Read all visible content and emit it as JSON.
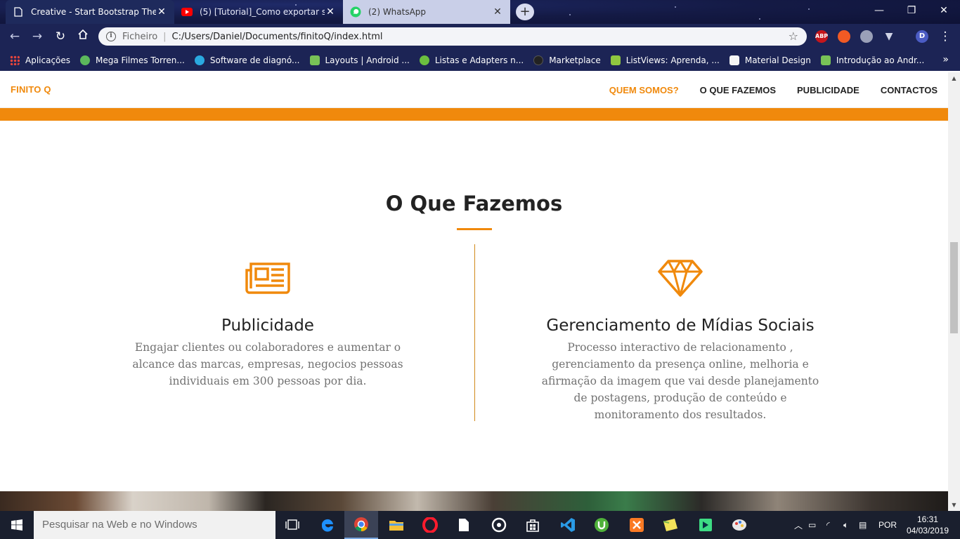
{
  "browser": {
    "tabs": [
      {
        "title": "Creative - Start Bootstrap Theme",
        "icon": "page-icon"
      },
      {
        "title": "(5) [Tutorial]_Como exportar seu",
        "icon": "youtube-icon"
      },
      {
        "title": "(2) WhatsApp",
        "icon": "whatsapp-icon"
      }
    ],
    "new_tab": "+",
    "address_scheme_label": "Ficheiro",
    "address_url": "C:/Users/Daniel/Documents/finitoQ/index.html",
    "extensions": [
      "ABP"
    ],
    "profile_initial": "D",
    "bookmarks": [
      {
        "label": "Aplicações",
        "color": "#e8453c"
      },
      {
        "label": "Mega Filmes Torren...",
        "color": "#5cb85c"
      },
      {
        "label": "Software de diagnó...",
        "color": "#2aa9e0"
      },
      {
        "label": "Layouts  |  Android ...",
        "color": "#78c257"
      },
      {
        "label": "Listas e Adapters n...",
        "color": "#6bbf3f"
      },
      {
        "label": "Marketplace",
        "color": "#222222"
      },
      {
        "label": "ListViews: Aprenda, ...",
        "color": "#8fc740"
      },
      {
        "label": "Material Design",
        "color": "#f5f5f5"
      },
      {
        "label": "Introdução ao Andr...",
        "color": "#78c257"
      }
    ],
    "bookmarks_more": "»"
  },
  "site": {
    "brand": "FINITO Q",
    "nav": [
      "QUEM SOMOS?",
      "O QUE FAZEMOS",
      "PUBLICIDADE",
      "CONTACTOS"
    ],
    "section_title": "O Que Fazemos",
    "services": [
      {
        "icon": "newspaper-icon",
        "title": "Publicidade",
        "text": "Engajar clientes ou colaboradores e aumentar o alcance das marcas, empresas, negocios pessoas individuais em 300 pessoas por dia."
      },
      {
        "icon": "diamond-icon",
        "title": "Gerenciamento de Mídias Sociais",
        "text": "Processo interactivo de relacionamento , gerenciamento da presença online, melhoria e afirmação da imagem que vai desde planejamento de postagens, produção de conteúdo e monitoramento dos resultados."
      }
    ],
    "accent_color": "#f0890c"
  },
  "taskbar": {
    "search_placeholder": "Pesquisar na Web e no Windows",
    "language": "POR",
    "time": "16:31",
    "date": "04/03/2019"
  }
}
